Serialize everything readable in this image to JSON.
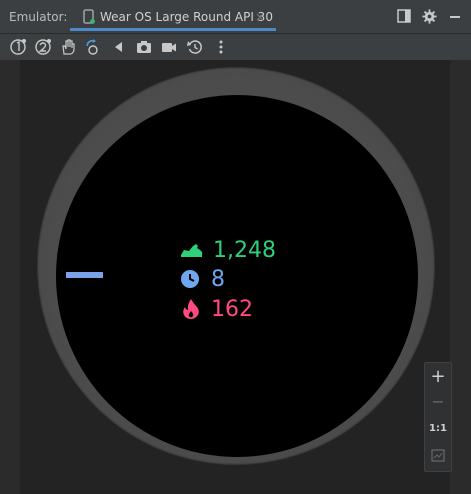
{
  "header": {
    "app_label": "Emulator:",
    "tab_label": "Wear OS Large Round API 30",
    "tab_close": "×"
  },
  "toolbar": {
    "icons": [
      "device-1-icon",
      "device-2-icon",
      "hand-icon",
      "rotate-icon",
      "back-icon",
      "camera-icon",
      "video-icon",
      "reset-icon",
      "more-icon"
    ]
  },
  "watch": {
    "steps": "1,248",
    "minutes": "8",
    "calories": "162",
    "steps_color": "#2fd07a",
    "minutes_color": "#6fa6ef",
    "calories_color": "#ff4a7f"
  },
  "zoom": {
    "plus": "+",
    "minus": "−",
    "one_to_one": "1:1"
  }
}
